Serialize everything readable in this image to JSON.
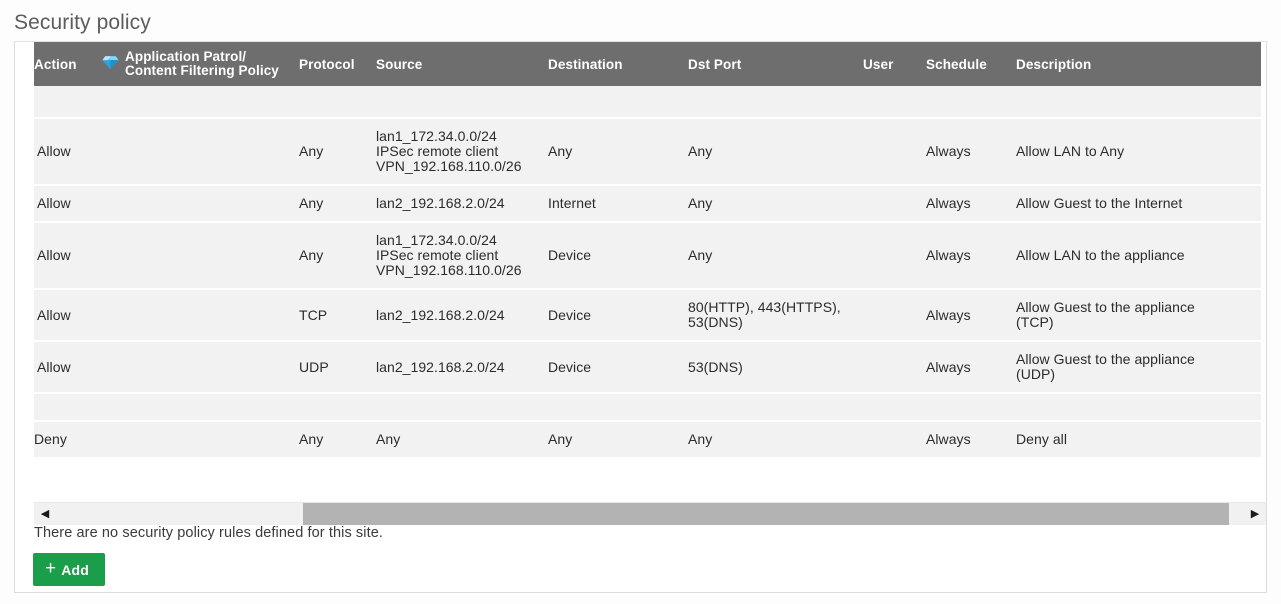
{
  "page": {
    "title": "Security policy",
    "empty_note": "There are no security policy rules defined for this site.",
    "add_label": "Add",
    "add_icon": "plus-icon"
  },
  "colors": {
    "header_bg": "#6e6e6e",
    "row_bg": "#f2f2f2",
    "add_button": "#1b9e49",
    "gem_icon": "#3fb6ef",
    "title_text": "#5c5c5c"
  },
  "table": {
    "columns": [
      {
        "key": "action",
        "label": "Action"
      },
      {
        "key": "app_policy",
        "label": "Application Patrol/\nContent Filtering Policy",
        "label_line1": "Application Patrol/",
        "label_line2": "Content Filtering Policy",
        "icon": "gem-icon"
      },
      {
        "key": "protocol",
        "label": "Protocol"
      },
      {
        "key": "source",
        "label": "Source"
      },
      {
        "key": "destination",
        "label": "Destination"
      },
      {
        "key": "dst_port",
        "label": "Dst Port"
      },
      {
        "key": "user",
        "label": "User"
      },
      {
        "key": "schedule",
        "label": "Schedule"
      },
      {
        "key": "description",
        "label": "Description"
      }
    ],
    "rows": [
      {
        "action": "Allow",
        "app_policy": "",
        "protocol": "Any",
        "source_lines": [
          "lan1_172.34.0.0/24",
          "IPSec remote client",
          "VPN_192.168.110.0/26"
        ],
        "destination": "Any",
        "dst_port_lines": [
          "Any"
        ],
        "user": "",
        "schedule": "Always",
        "description_lines": [
          "Allow LAN to Any"
        ]
      },
      {
        "action": "Allow",
        "app_policy": "",
        "protocol": "Any",
        "source_lines": [
          "lan2_192.168.2.0/24"
        ],
        "destination": "Internet",
        "dst_port_lines": [
          "Any"
        ],
        "user": "",
        "schedule": "Always",
        "description_lines": [
          "Allow Guest to the Internet"
        ]
      },
      {
        "action": "Allow",
        "app_policy": "",
        "protocol": "Any",
        "source_lines": [
          "lan1_172.34.0.0/24",
          "IPSec remote client",
          "VPN_192.168.110.0/26"
        ],
        "destination": "Device",
        "dst_port_lines": [
          "Any"
        ],
        "user": "",
        "schedule": "Always",
        "description_lines": [
          "Allow LAN to the appliance"
        ]
      },
      {
        "action": "Allow",
        "app_policy": "",
        "protocol": "TCP",
        "source_lines": [
          "lan2_192.168.2.0/24"
        ],
        "destination": "Device",
        "dst_port_lines": [
          "80(HTTP), 443(HTTPS),",
          "53(DNS)"
        ],
        "user": "",
        "schedule": "Always",
        "description_lines": [
          "Allow Guest to the appliance",
          "(TCP)"
        ]
      },
      {
        "action": "Allow",
        "app_policy": "",
        "protocol": "UDP",
        "source_lines": [
          "lan2_192.168.2.0/24"
        ],
        "destination": "Device",
        "dst_port_lines": [
          "53(DNS)"
        ],
        "user": "",
        "schedule": "Always",
        "description_lines": [
          "Allow Guest to the appliance",
          "(UDP)"
        ]
      }
    ],
    "default_row": {
      "action": "Deny",
      "app_policy": "",
      "protocol": "Any",
      "source_lines": [
        "Any"
      ],
      "destination": "Any",
      "dst_port_lines": [
        "Any"
      ],
      "user": "",
      "schedule": "Always",
      "description_lines": [
        "Deny all"
      ]
    }
  },
  "scrollbar": {
    "left_arrow": "◀",
    "right_arrow": "▶",
    "orientation": "horizontal"
  }
}
